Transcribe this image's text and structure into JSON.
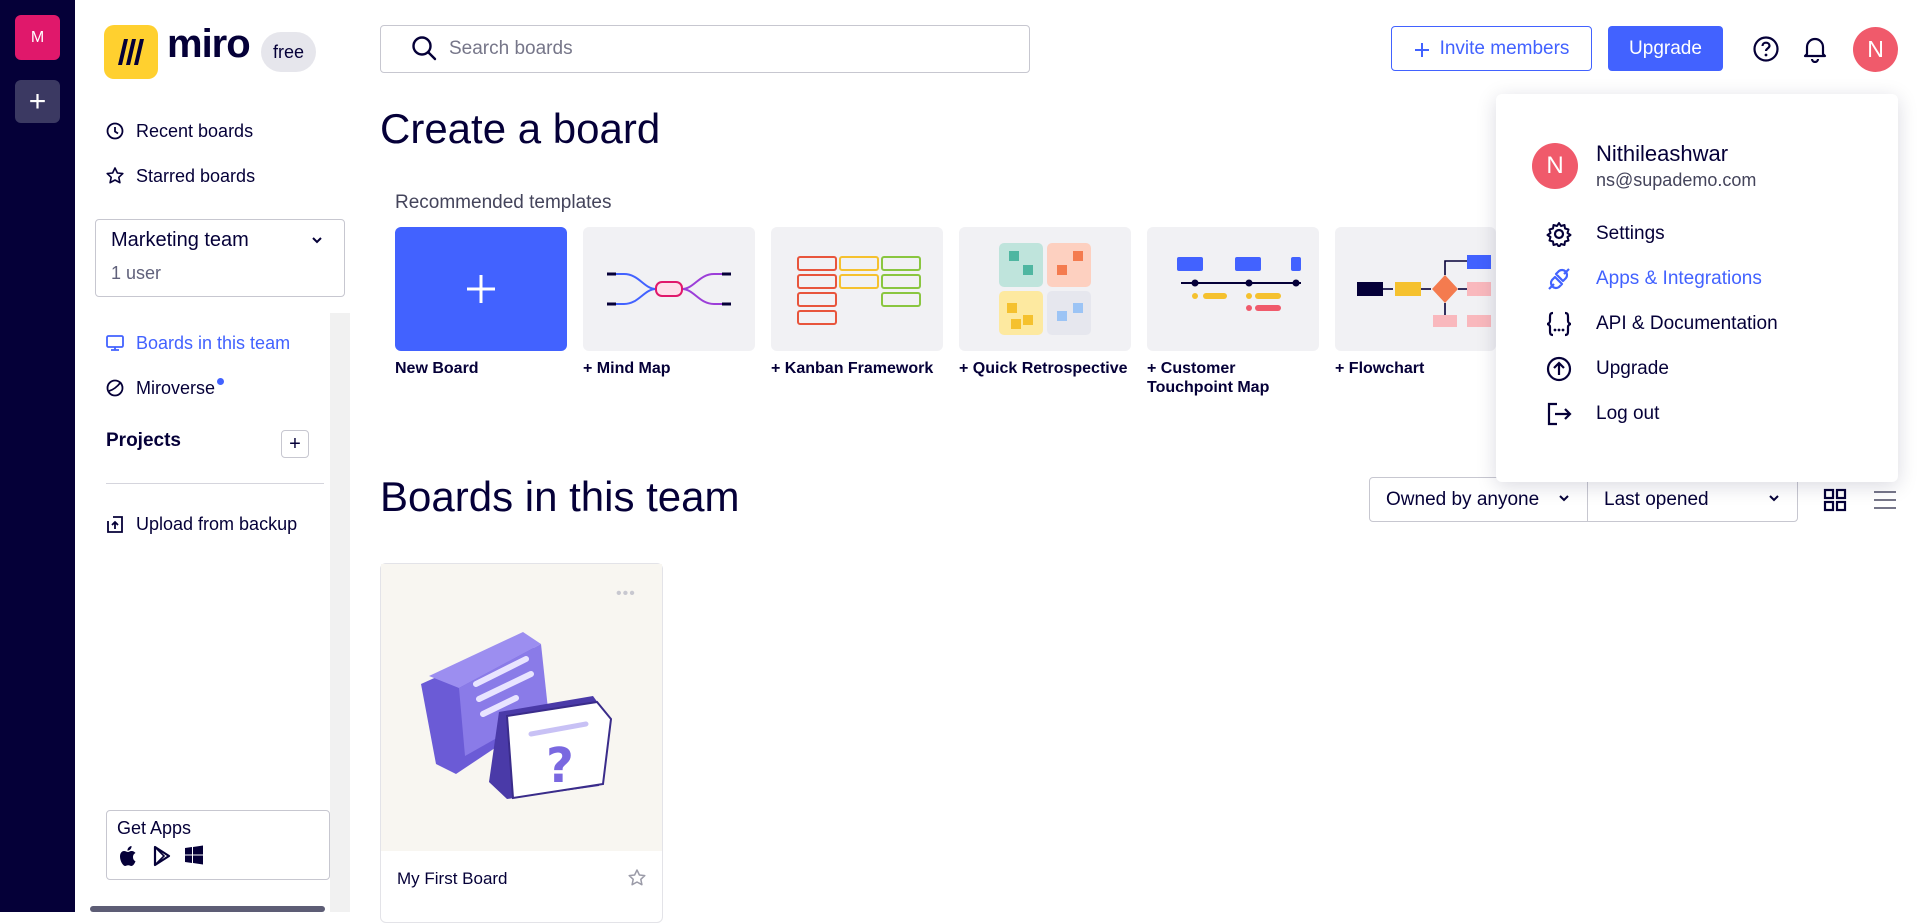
{
  "rail": {
    "team_initial": "M",
    "add_label": "+"
  },
  "brand": {
    "name": "miro",
    "plan": "free"
  },
  "sidebar": {
    "links_top": [
      {
        "label": "Recent boards",
        "icon": "clock-icon"
      },
      {
        "label": "Starred boards",
        "icon": "star-icon"
      }
    ],
    "team": {
      "name": "Marketing team",
      "users": "1 user"
    },
    "links_team": [
      {
        "label": "Boards in this team",
        "icon": "boards-icon",
        "active": true
      },
      {
        "label": "Miroverse",
        "icon": "miroverse-icon",
        "has_dot": true
      }
    ],
    "projects_title": "Projects",
    "projects_add": "+",
    "upload_label": "Upload from backup",
    "get_apps_label": "Get Apps",
    "app_icons": [
      "apple-icon",
      "google-play-icon",
      "windows-icon"
    ]
  },
  "topbar": {
    "search_placeholder": "Search boards",
    "invite_label": "Invite members",
    "upgrade_label": "Upgrade",
    "avatar_initial": "N"
  },
  "create": {
    "title": "Create a board",
    "recommended_title": "Recommended templates",
    "templates": [
      {
        "label": "New Board",
        "key": "new"
      },
      {
        "label": "+ Mind Map",
        "key": "mindmap"
      },
      {
        "label": "+ Kanban Framework",
        "key": "kanban"
      },
      {
        "label": "+ Quick Retrospective",
        "key": "retro"
      },
      {
        "label": "+ Customer Touchpoint Map",
        "key": "touchpoint"
      },
      {
        "label": "+ Flowchart",
        "key": "flowchart"
      }
    ]
  },
  "boards": {
    "title": "Boards in this team",
    "owner_filter": "Owned by anyone",
    "sort_filter": "Last opened",
    "items": [
      {
        "name": "My First Board",
        "dots": "•••"
      }
    ]
  },
  "account_menu": {
    "avatar_initial": "N",
    "name": "Nithileashwar",
    "email": "ns@supademo.com",
    "items": [
      {
        "label": "Settings",
        "icon": "gear-icon"
      },
      {
        "label": "Apps & Integrations",
        "icon": "plug-icon",
        "active": true
      },
      {
        "label": "API & Documentation",
        "icon": "code-braces-icon"
      },
      {
        "label": "Upgrade",
        "icon": "arrow-up-circle-icon"
      },
      {
        "label": "Log out",
        "icon": "logout-icon"
      }
    ]
  },
  "colors": {
    "accent": "#4262ff",
    "rail": "#050038",
    "team_badge": "#e0186b",
    "avatar": "#f05a6b",
    "logo": "#ffd02f"
  }
}
